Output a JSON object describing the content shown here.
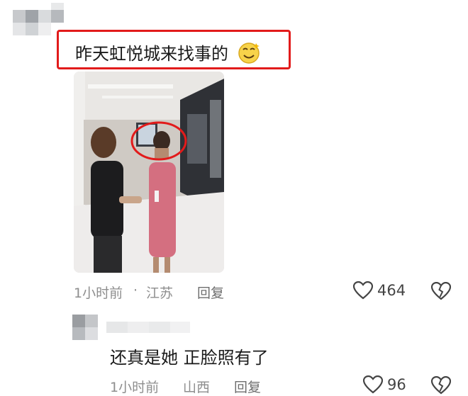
{
  "comment1": {
    "text": "昨天虹悦城来找事的",
    "emoji": "smiling-face-emoji",
    "time": "1小时前",
    "location": "江苏",
    "reply_label": "回复",
    "like_count": "464"
  },
  "comment2": {
    "text": "还真是她 正脸照有了",
    "time": "1小时前",
    "location": "山西",
    "reply_label": "回复",
    "like_count": "96"
  },
  "colors": {
    "highlight_box": "#e21b1b",
    "meta_text": "#8e8e8e",
    "body_text": "#1a1a1a"
  }
}
